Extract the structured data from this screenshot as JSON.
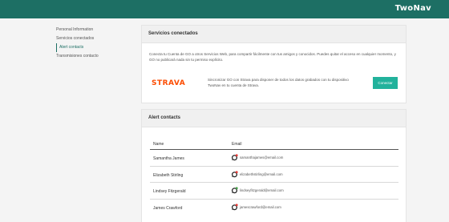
{
  "header": {
    "brand": "TwoNav"
  },
  "sidebar": {
    "items": [
      {
        "label": "Personal Information",
        "active": false
      },
      {
        "label": "Servicios conectados",
        "active": false
      },
      {
        "label": "Alert contacts",
        "active": true
      },
      {
        "label": "Transmisiones contacto",
        "active": false
      }
    ]
  },
  "services_card": {
    "title": "Servicios conectados",
    "description": "Conecta tu Cuenta de GO a otros Servicios Web, para compartir fácilmente con tus amigos y conocidos. Puedes quitar el acceso en cualquier momento, y GO no publicará nada sin tu permiso explícito.",
    "strava": {
      "logo_text": "STRAVA",
      "description": "Sincronizar GO con Strava para disponer de todos los datos grabados con tu dispositivo TwoNav en tu cuenta de Strava.",
      "button_label": "Conectar"
    }
  },
  "alerts_card": {
    "title": "Alert contacts",
    "columns": {
      "name": "Name",
      "email": "Email"
    },
    "rows": [
      {
        "name": "Samantha James",
        "email": "samanthajames@email.com",
        "status": "red"
      },
      {
        "name": "Elizabeth Stirling",
        "email": "elizabethstirling@email.com",
        "status": "red"
      },
      {
        "name": "Lindsey Fitzgerald",
        "email": "lindseyfitzgerald@email.com",
        "status": "green"
      },
      {
        "name": "James Crawford",
        "email": "jamescrawford@email.com",
        "status": "red"
      }
    ]
  },
  "colors": {
    "brand": "#1d6f64",
    "button": "#22b29c",
    "strava": "#fc4c02",
    "status_red": "#e53935",
    "status_green": "#43a047"
  },
  "icons": {
    "contact_icon": "whatsapp-icon"
  }
}
